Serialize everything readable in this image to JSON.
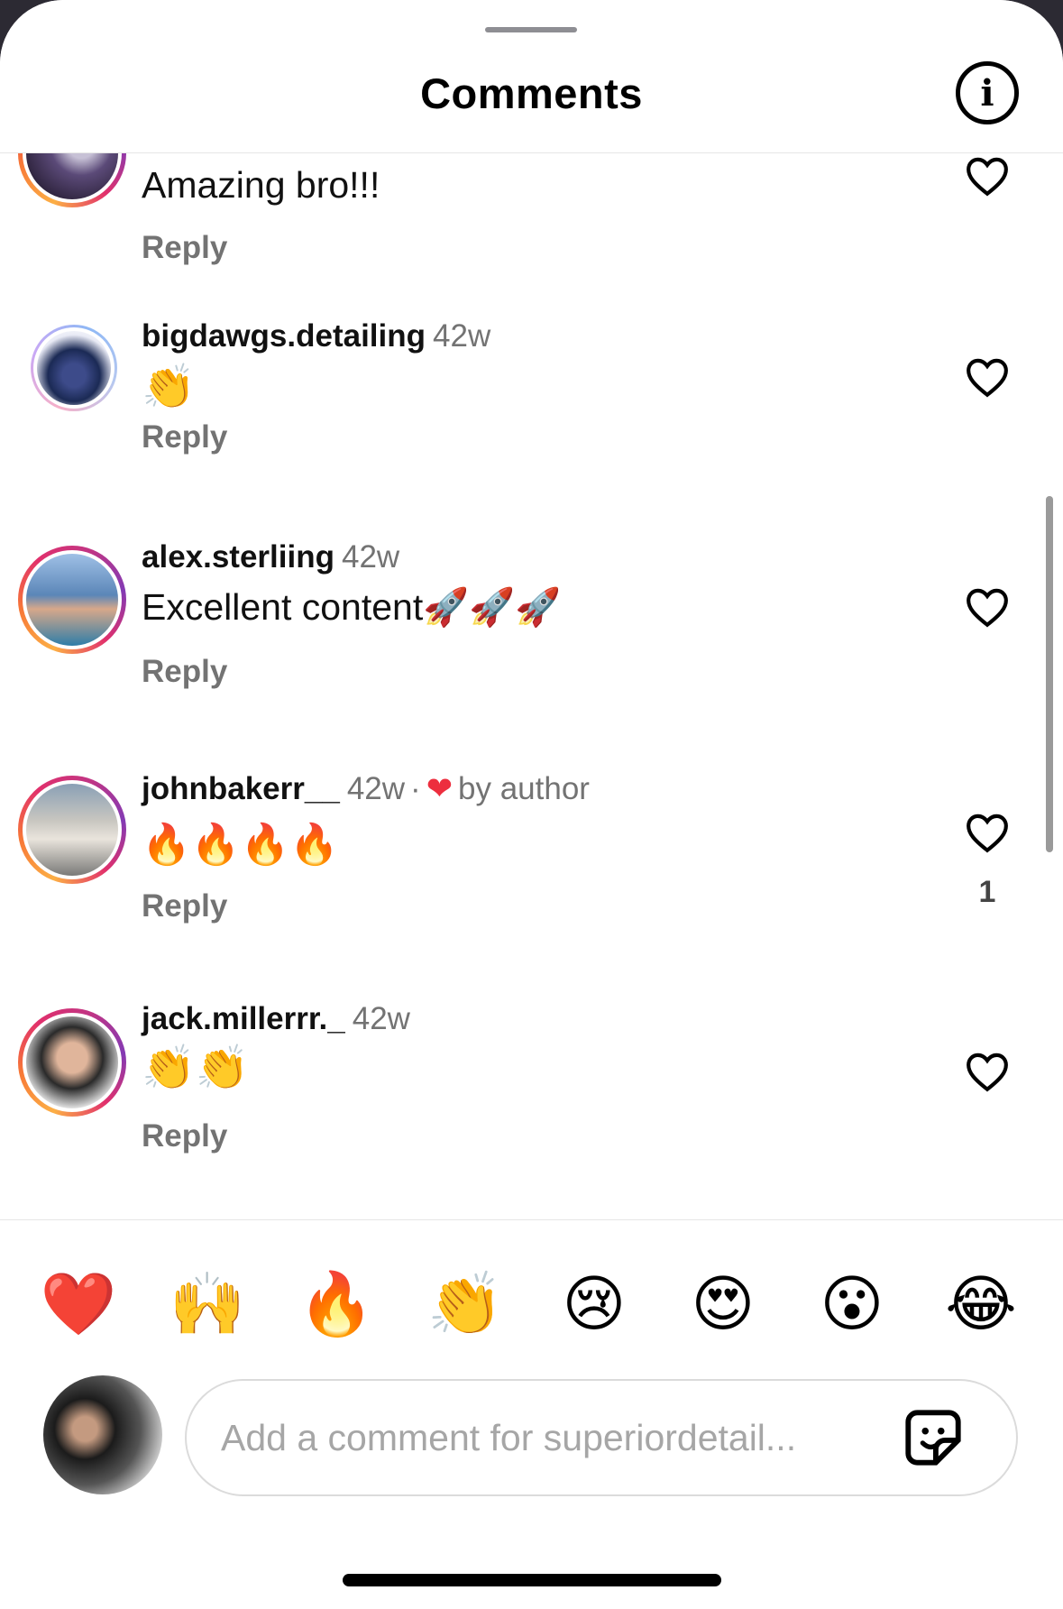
{
  "header": {
    "title": "Comments",
    "info_icon": "i"
  },
  "comments": [
    {
      "username": "",
      "time": "",
      "text": "Amazing bro!!!",
      "reply": "Reply",
      "likes": ""
    },
    {
      "username": "bigdawgs.detailing",
      "time": "42w",
      "text": "👏",
      "reply": "Reply",
      "likes": ""
    },
    {
      "username": "alex.sterliing",
      "time": "42w",
      "text": "Excellent content🚀🚀🚀",
      "reply": "Reply",
      "likes": ""
    },
    {
      "username": "johnbakerr__",
      "time": "42w",
      "separator": "·",
      "author_heart": "❤",
      "author_label": "by author",
      "text": "🔥🔥🔥🔥",
      "reply": "Reply",
      "likes": "1"
    },
    {
      "username": "jack.millerrr._",
      "time": "42w",
      "text": "👏👏",
      "reply": "Reply",
      "likes": ""
    }
  ],
  "reactions": [
    "❤️",
    "🙌",
    "🔥",
    "👏",
    "😢",
    "😍",
    "😮",
    "😂"
  ],
  "composer": {
    "placeholder": "Add a comment for superiordetail..."
  },
  "colors": {
    "accent_heart": "#ed2e3e",
    "secondary_text": "#737373"
  }
}
